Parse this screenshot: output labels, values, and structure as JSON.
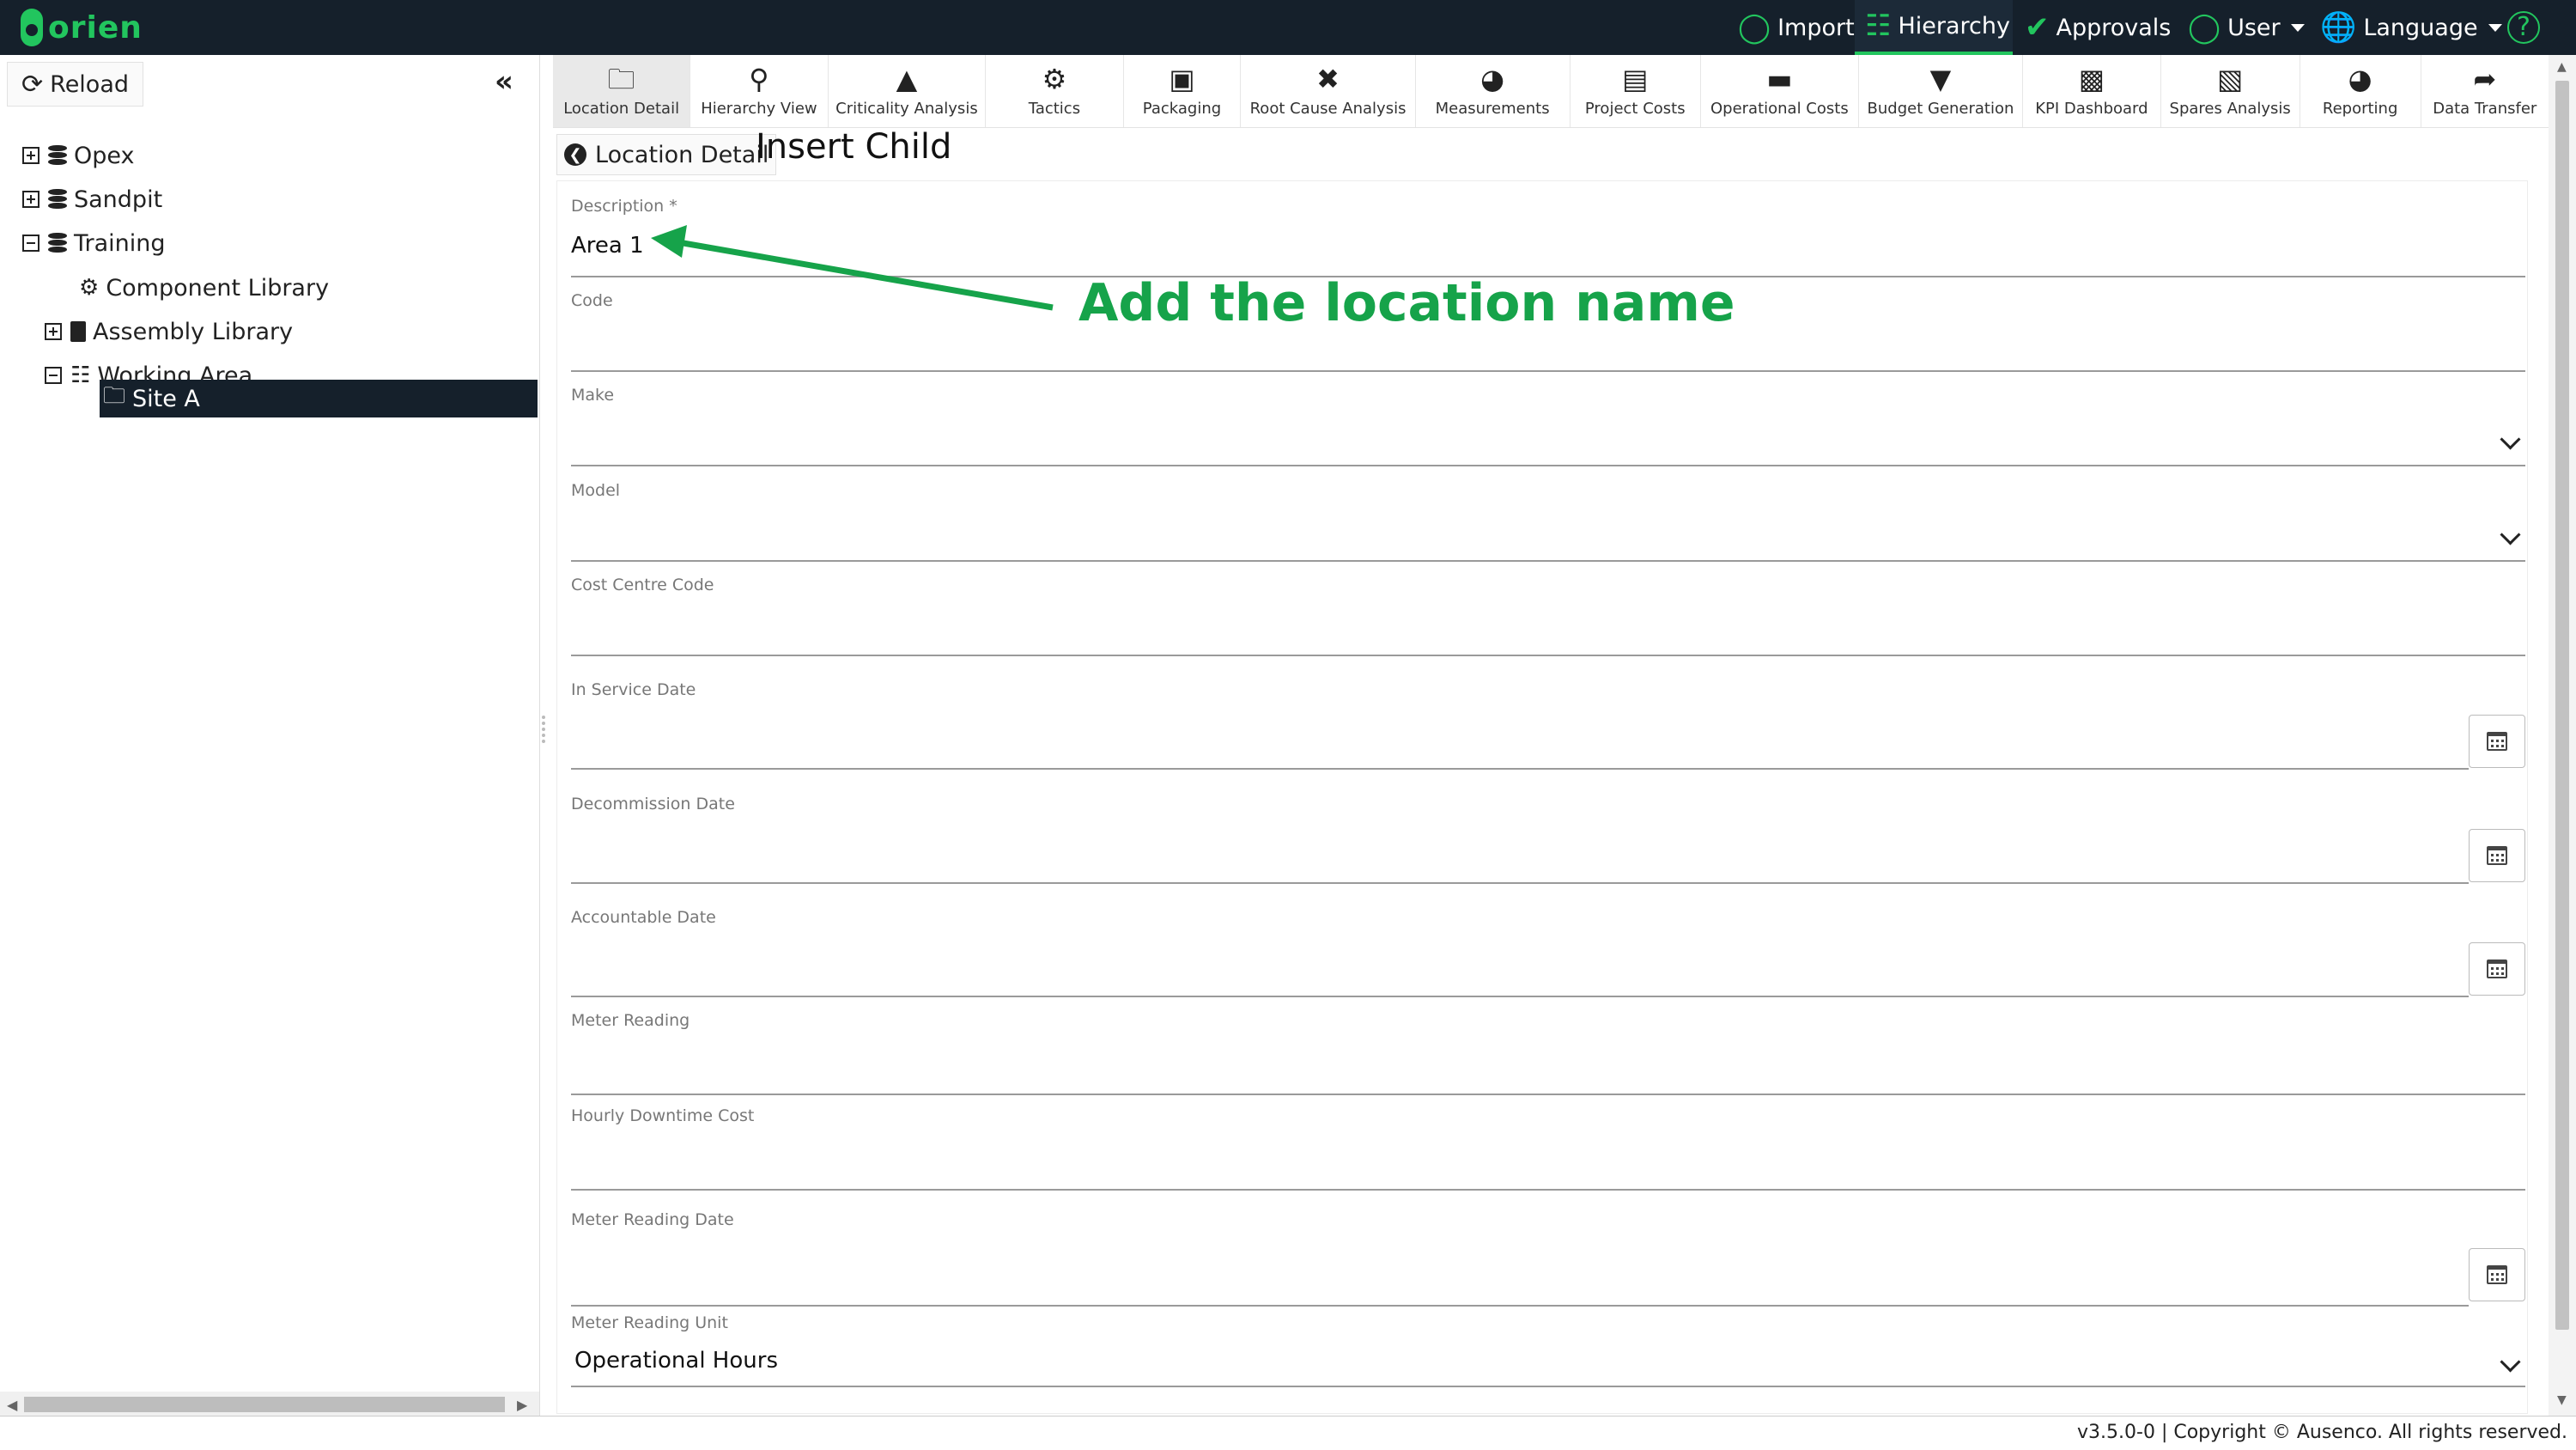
{
  "app": {
    "logo_text": "orien"
  },
  "topnav": {
    "import": "Import",
    "hierarchy": "Hierarchy",
    "approvals": "Approvals",
    "user": "User",
    "language": "Language"
  },
  "sidebar": {
    "reload_label": "Reload",
    "tree": {
      "opex": "Opex",
      "sandpit": "Sandpit",
      "training": "Training",
      "component_library": "Component Library",
      "assembly_library": "Assembly Library",
      "working_area": "Working Area",
      "site_a": "Site A"
    }
  },
  "toolbar": [
    "Location Detail",
    "Hierarchy View",
    "Criticality Analysis",
    "Tactics",
    "Packaging",
    "Root Cause Analysis",
    "Measurements",
    "Project Costs",
    "Operational Costs",
    "Budget Generation",
    "KPI Dashboard",
    "Spares Analysis",
    "Reporting",
    "Data Transfer"
  ],
  "header": {
    "back_label": "Location Detail",
    "title": "Insert Child"
  },
  "form": {
    "description": {
      "label": "Description *",
      "value": "Area 1"
    },
    "code": {
      "label": "Code",
      "value": ""
    },
    "make": {
      "label": "Make",
      "value": ""
    },
    "model": {
      "label": "Model",
      "value": ""
    },
    "cost_centre_code": {
      "label": "Cost Centre Code",
      "value": ""
    },
    "in_service_date": {
      "label": "In Service Date",
      "value": ""
    },
    "decommission_date": {
      "label": "Decommission Date",
      "value": ""
    },
    "accountable_date": {
      "label": "Accountable Date",
      "value": ""
    },
    "meter_reading": {
      "label": "Meter Reading",
      "value": ""
    },
    "hourly_downtime_cost": {
      "label": "Hourly Downtime Cost",
      "value": ""
    },
    "meter_reading_date": {
      "label": "Meter Reading Date",
      "value": ""
    },
    "meter_reading_unit": {
      "label": "Meter Reading Unit",
      "value": "Operational Hours"
    }
  },
  "annotation": {
    "text": "Add the location name",
    "color": "#16a34a"
  },
  "footer": {
    "text": "v3.5.0-0 | Copyright © Ausenco. All rights reserved."
  },
  "colors": {
    "topbar": "#15202b",
    "accent": "#22c55e"
  }
}
